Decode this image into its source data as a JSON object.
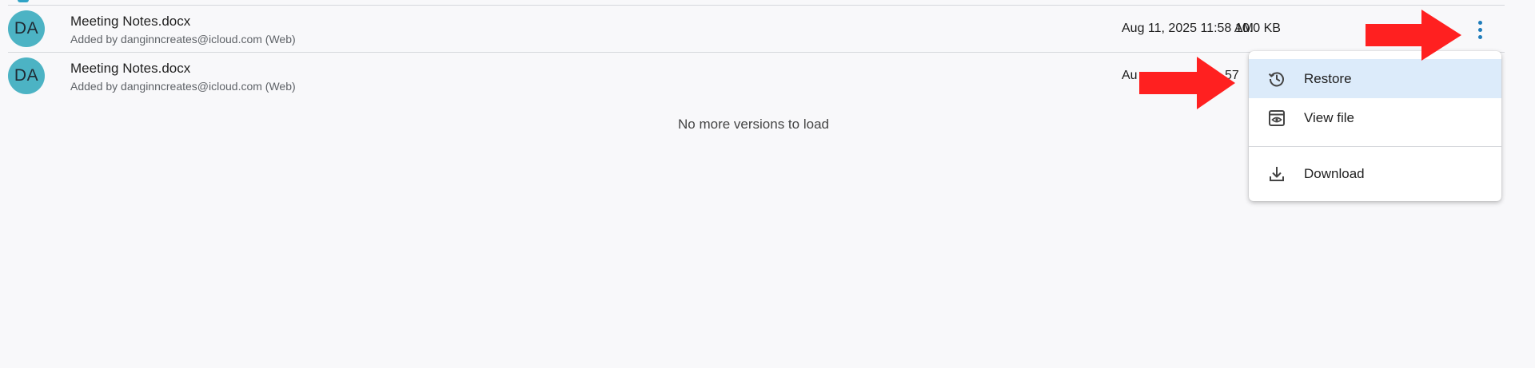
{
  "versions": [
    {
      "avatar_initials": "DA",
      "file_name": "Meeting Notes.docx",
      "added_by": "Added by danginncreates@icloud.com (Web)",
      "date": "Aug 11, 2025 11:58 AM",
      "size": "10.0 KB"
    },
    {
      "avatar_initials": "DA",
      "file_name": "Meeting Notes.docx",
      "added_by": "Added by danginncreates@icloud.com (Web)",
      "date_partial": "Au",
      "date_partial_tail": "57"
    }
  ],
  "status_message": "No more versions to load",
  "context_menu": {
    "items": [
      {
        "label": "Restore",
        "icon": "restore-history-icon",
        "highlighted": true
      },
      {
        "label": "View file",
        "icon": "view-file-icon",
        "highlighted": false
      },
      {
        "label": "Download",
        "icon": "download-icon",
        "highlighted": false
      }
    ]
  },
  "colors": {
    "avatar": "#4cb3c4",
    "kebab": "#1f7dbb",
    "menu_highlight": "#dcebfa",
    "annotation_arrow": "#ff2020"
  }
}
